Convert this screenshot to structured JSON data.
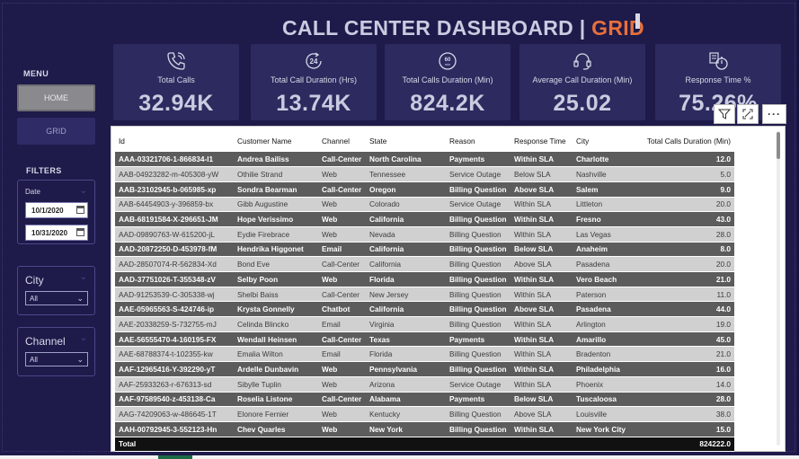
{
  "header": {
    "title_main": "CALL CENTER  DASHBOARD | ",
    "title_accent": "GRID",
    "accent_color": "#e8703a"
  },
  "menu": {
    "label": "MENU",
    "home_label": "HOME",
    "grid_label": "GRID"
  },
  "filters": {
    "label": "FILTERS",
    "date": {
      "label": "Date",
      "start": "10/1/2020",
      "end": "10/31/2020"
    },
    "city": {
      "label": "City",
      "selected": "All"
    },
    "channel": {
      "label": "Channel",
      "selected": "All"
    }
  },
  "kpis": [
    {
      "label": "Total Calls",
      "value": "32.94K",
      "icon": "phone-icon"
    },
    {
      "label": "Total Call Duration (Hrs)",
      "value": "13.74K",
      "icon": "24-hour-clock-icon"
    },
    {
      "label": "Total Calls Duration (Min)",
      "value": "824.2K",
      "icon": "60-minute-timer-icon"
    },
    {
      "label": "Average Call Duration (Min)",
      "value": "25.02",
      "icon": "headset-icon"
    },
    {
      "label": "Response Time %",
      "value": "75.26%",
      "icon": "stopwatch-checklist-icon"
    }
  ],
  "toolbar": {
    "filter_icon": "filter-icon",
    "focus_icon": "focus-mode-icon",
    "more_label": "···"
  },
  "table": {
    "columns": [
      "Id",
      "Customer Name",
      "Channel",
      "State",
      "Reason",
      "Response Time",
      "City",
      "Total Calls Duration (Min)"
    ],
    "rows": [
      [
        "AAA-03321706-1-866834-I1",
        "Andrea Bailiss",
        "Call-Center",
        "North Carolina",
        "Payments",
        "Within SLA",
        "Charlotte",
        "12.0"
      ],
      [
        "AAB-04923282-m-405308-yW",
        "Othilie Strand",
        "Web",
        "Tennessee",
        "Service Outage",
        "Below SLA",
        "Nashville",
        "5.0"
      ],
      [
        "AAB-23102945-b-065985-xp",
        "Sondra Bearman",
        "Call-Center",
        "Oregon",
        "Billing Question",
        "Above SLA",
        "Salem",
        "9.0"
      ],
      [
        "AAB-64454903-y-396859-bx",
        "Gibb Augustine",
        "Web",
        "Colorado",
        "Service Outage",
        "Within SLA",
        "Littleton",
        "20.0"
      ],
      [
        "AAB-68191584-X-296651-JM",
        "Hope Verissimo",
        "Web",
        "California",
        "Billing Question",
        "Within SLA",
        "Fresno",
        "43.0"
      ],
      [
        "AAD-09890763-W-615200-jL",
        "Eydie Firebrace",
        "Web",
        "Nevada",
        "Billing Question",
        "Within SLA",
        "Las Vegas",
        "28.0"
      ],
      [
        "AAD-20872250-D-453978-fM",
        "Hendrika Higgonet",
        "Email",
        "California",
        "Billing Question",
        "Below SLA",
        "Anaheim",
        "8.0"
      ],
      [
        "AAD-28507074-R-562834-Xd",
        "Bond Eve",
        "Call-Center",
        "California",
        "Billing Question",
        "Above SLA",
        "Pasadena",
        "20.0"
      ],
      [
        "AAD-37751026-T-355348-zV",
        "Selby Poon",
        "Web",
        "Florida",
        "Billing Question",
        "Within SLA",
        "Vero Beach",
        "21.0"
      ],
      [
        "AAD-91253539-C-305338-wj",
        "Shelbi Baiss",
        "Call-Center",
        "New Jersey",
        "Billing Question",
        "Within SLA",
        "Paterson",
        "11.0"
      ],
      [
        "AAE-05965563-S-424746-ip",
        "Krysta Gonnelly",
        "Chatbot",
        "California",
        "Billing Question",
        "Above SLA",
        "Pasadena",
        "44.0"
      ],
      [
        "AAE-20338259-S-732755-mJ",
        "Celinda Blincko",
        "Email",
        "Virginia",
        "Billing Question",
        "Within SLA",
        "Arlington",
        "19.0"
      ],
      [
        "AAE-56555470-4-160195-FX",
        "Wendall Heinsen",
        "Call-Center",
        "Texas",
        "Payments",
        "Within SLA",
        "Amarillo",
        "45.0"
      ],
      [
        "AAE-68788374-t-102355-kw",
        "Emalia Wilton",
        "Email",
        "Florida",
        "Billing Question",
        "Within SLA",
        "Bradenton",
        "21.0"
      ],
      [
        "AAF-12965416-Y-392290-yT",
        "Ardelle Dunbavin",
        "Web",
        "Pennsylvania",
        "Billing Question",
        "Within SLA",
        "Philadelphia",
        "16.0"
      ],
      [
        "AAF-25933263-r-676313-sd",
        "Sibylle Tuplin",
        "Web",
        "Arizona",
        "Service Outage",
        "Within SLA",
        "Phoenix",
        "14.0"
      ],
      [
        "AAF-97589540-z-453138-Ca",
        "Roselia Listone",
        "Call-Center",
        "Alabama",
        "Payments",
        "Below SLA",
        "Tuscaloosa",
        "28.0"
      ],
      [
        "AAG-74209063-w-486645-1T",
        "Elonore Fernier",
        "Web",
        "Kentucky",
        "Billing Question",
        "Above SLA",
        "Louisville",
        "38.0"
      ],
      [
        "AAH-00792945-3-552123-Hn",
        "Chev Quarles",
        "Web",
        "New York",
        "Billing Question",
        "Within SLA",
        "New York City",
        "15.0"
      ]
    ],
    "total_label": "Total",
    "total_value": "824222.0"
  }
}
